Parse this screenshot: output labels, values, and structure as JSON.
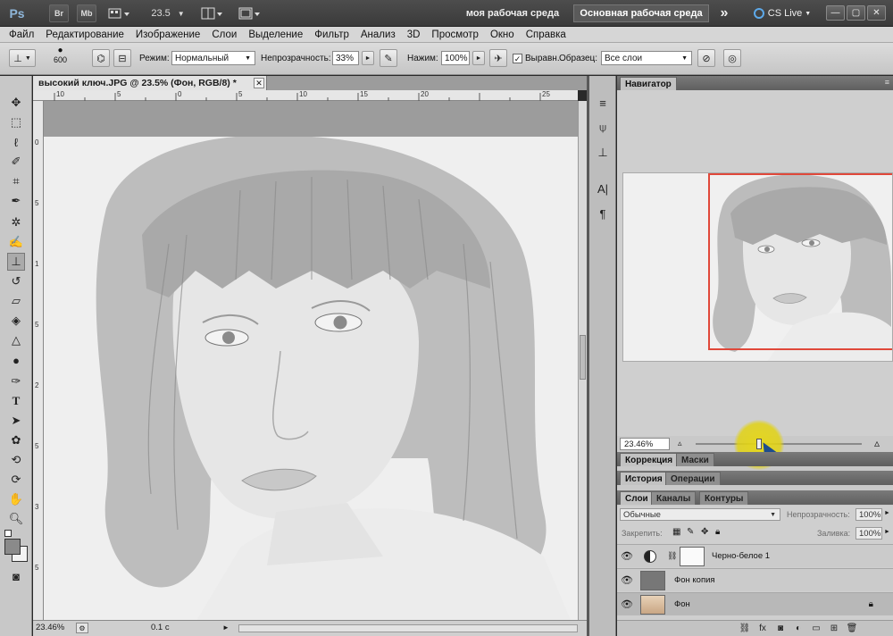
{
  "app": {
    "logo": "Ps",
    "bridge_label": "Br",
    "minibridge_label": "Mb",
    "zoom_dropdown": "23.5",
    "workspace_custom": "моя рабочая среда",
    "workspace_main": "Основная рабочая среда",
    "more_label": "»",
    "cslive_label": "CS Live"
  },
  "menu": [
    "Файл",
    "Редактирование",
    "Изображение",
    "Слои",
    "Выделение",
    "Фильтр",
    "Анализ",
    "3D",
    "Просмотр",
    "Окно",
    "Справка"
  ],
  "options": {
    "brush_size": "600",
    "mode_label": "Режим:",
    "mode_value": "Нормальный",
    "opacity_label": "Непрозрачность:",
    "opacity_value": "33%",
    "flow_label": "Нажим:",
    "flow_value": "100%",
    "aligned_label": "Выравн.",
    "sample_label": "Образец:",
    "sample_value": "Все слои"
  },
  "document": {
    "tab_title": "высокий ключ.JPG @ 23.5% (Фон, RGB/8) *",
    "ruler_top": [
      "10",
      "5",
      "0",
      "5",
      "10",
      "15",
      "20",
      "25"
    ],
    "ruler_left": [
      "0",
      "5",
      "1",
      "5",
      "2",
      "5",
      "3",
      "5"
    ],
    "zoom_status": "23.46%",
    "timing": "0.1 с"
  },
  "navigator": {
    "tab": "Навигатор",
    "zoom_value": "23.46%",
    "zoom_level": 0.38
  },
  "panels": {
    "adjust_tabs": [
      "Коррекция",
      "Маски"
    ],
    "history_tabs": [
      "История",
      "Операции"
    ],
    "layers_tabs": [
      "Слои",
      "Каналы",
      "Контуры"
    ],
    "blend_mode": "Обычные",
    "opacity_label": "Непрозрачность:",
    "opacity_value": "100%",
    "lock_label": "Закрепить:",
    "fill_label": "Заливка:",
    "fill_value": "100%"
  },
  "layers": [
    {
      "name": "Черно-белое 1",
      "visible": true
    },
    {
      "name": "Фон копия",
      "visible": true
    },
    {
      "name": "Фон",
      "visible": true,
      "selected": true,
      "locked": true
    }
  ],
  "colors": {
    "nav_frame": "#e0483a",
    "highlight": "#e6d714",
    "cursor": "#1e4d8c"
  }
}
